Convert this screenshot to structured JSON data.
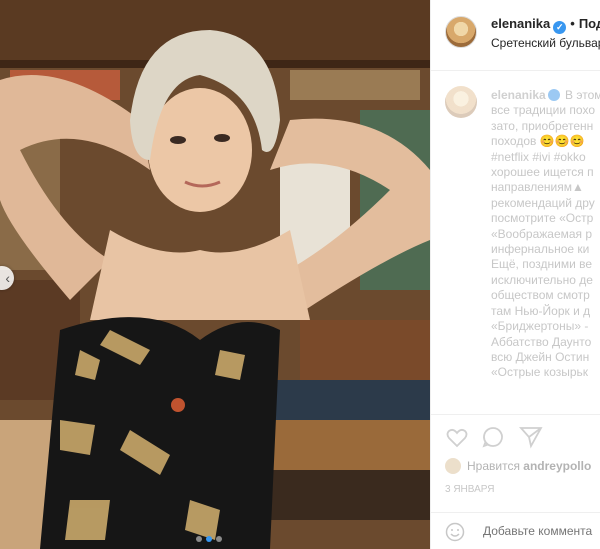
{
  "post": {
    "username": "elenanika",
    "follow_label": "Под",
    "location": "Сретенский бульвар"
  },
  "caption": {
    "lines": [
      "В этом",
      "все традиции похо",
      "зато, приобретенн",
      "походов",
      "#netflix #ivi #okko",
      "хорошее ищется п",
      "направлениям",
      "рекомендаций дру",
      "посмотрите «Остр",
      "«Воображаемая р",
      "инфернальное ки",
      "Ещё, поздними ве",
      "исключительно де",
      "обществом смотр",
      "там Нью-Йорк и д",
      "«Бриджертоны» -",
      "Аббатство Даунто",
      "всю Джейн Остин",
      "«Острые козырьк"
    ]
  },
  "likes": {
    "prefix": "Нравится",
    "user": "andreypollo"
  },
  "date": "3 ЯНВАРЯ",
  "comment": {
    "placeholder": "Добавьте коммента"
  },
  "colors": {
    "accent": "#3897f0",
    "border": "#efefef"
  },
  "icons": [
    "heart-icon",
    "comment-icon",
    "share-icon",
    "smile-icon",
    "verified-icon",
    "chevron-left-icon"
  ]
}
